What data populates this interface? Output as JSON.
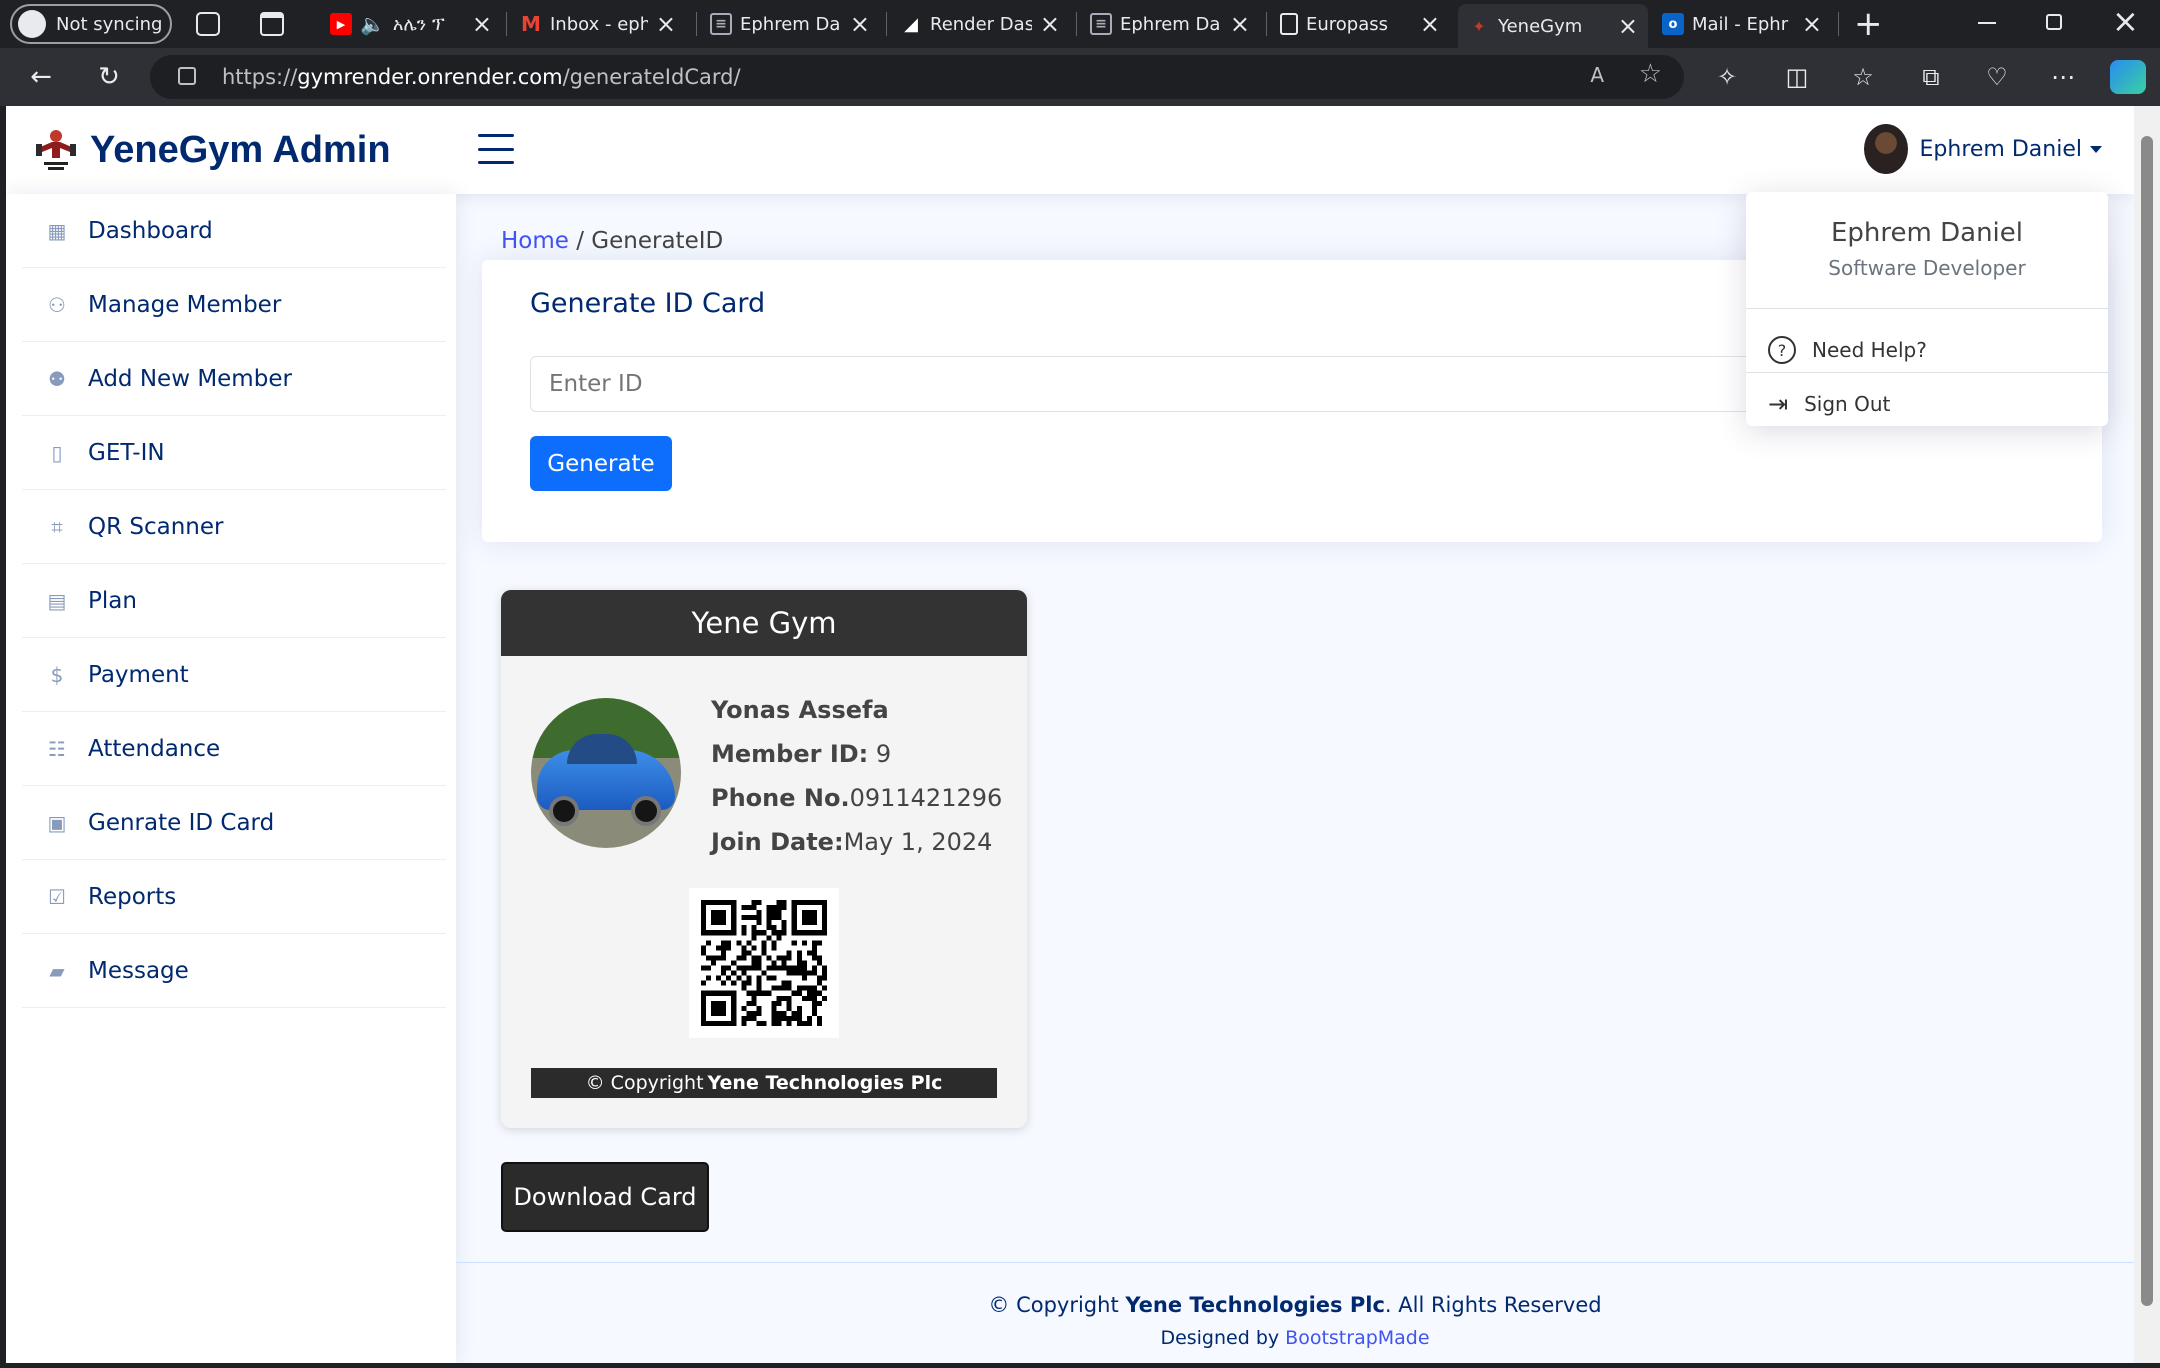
{
  "browser": {
    "profile_label": "Not syncing",
    "tabs": [
      {
        "title": "አሌን ፕ",
        "icon": "youtube-icon"
      },
      {
        "title": "Inbox - eph",
        "icon": "gmail-icon"
      },
      {
        "title": "Ephrem Dar",
        "icon": "document-icon"
      },
      {
        "title": "Render Dasl",
        "icon": "render-icon"
      },
      {
        "title": "Ephrem Dar",
        "icon": "document-icon"
      },
      {
        "title": "Europass",
        "icon": "page-icon"
      },
      {
        "title": "YeneGym",
        "icon": "gym-icon"
      },
      {
        "title": "Mail - Ephr",
        "icon": "outlook-icon"
      }
    ],
    "url_prefix": "https://",
    "url_host": "gymrender.onrender.com",
    "url_path": "/generateIdCard/"
  },
  "header": {
    "app_title": "YeneGym Admin",
    "user_name": "Ephrem Daniel"
  },
  "sidebar": {
    "items": [
      {
        "label": "Dashboard",
        "icon": "grid-icon"
      },
      {
        "label": "Manage Member",
        "icon": "people-icon"
      },
      {
        "label": "Add New Member",
        "icon": "person-add-icon"
      },
      {
        "label": "GET-IN",
        "icon": "door-icon"
      },
      {
        "label": "QR Scanner",
        "icon": "qr-scan-icon"
      },
      {
        "label": "Plan",
        "icon": "calendar-icon"
      },
      {
        "label": "Payment",
        "icon": "dollar-icon"
      },
      {
        "label": "Attendance",
        "icon": "list-card-icon"
      },
      {
        "label": "Genrate ID Card",
        "icon": "id-badge-icon"
      },
      {
        "label": "Reports",
        "icon": "check-file-icon"
      },
      {
        "label": "Message",
        "icon": "chat-icon"
      }
    ]
  },
  "breadcrumb": {
    "home": "Home",
    "sep": " / ",
    "current": "GenerateID"
  },
  "generate": {
    "title": "Generate ID Card",
    "placeholder": "Enter ID",
    "button": "Generate"
  },
  "id_card": {
    "gym_name": "Yene Gym",
    "member_name": "Yonas Assefa",
    "member_id_label": "Member ID:",
    "member_id": " 9",
    "phone_label": "Phone No.",
    "phone": "0911421296",
    "join_label": "Join Date:",
    "join_date": "May 1, 2024",
    "copyright_prefix": "© Copyright",
    "copyright_company": "Yene Technologies Plc"
  },
  "download_button": "Download Card",
  "footer": {
    "prefix": "© Copyright ",
    "company": "Yene Technologies Plc",
    "suffix": ". All Rights Reserved",
    "designed_by": "Designed by ",
    "designer": "BootstrapMade"
  },
  "profile_menu": {
    "name": "Ephrem Daniel",
    "role": "Software Developer",
    "help": "Need Help?",
    "signout": "Sign Out"
  }
}
